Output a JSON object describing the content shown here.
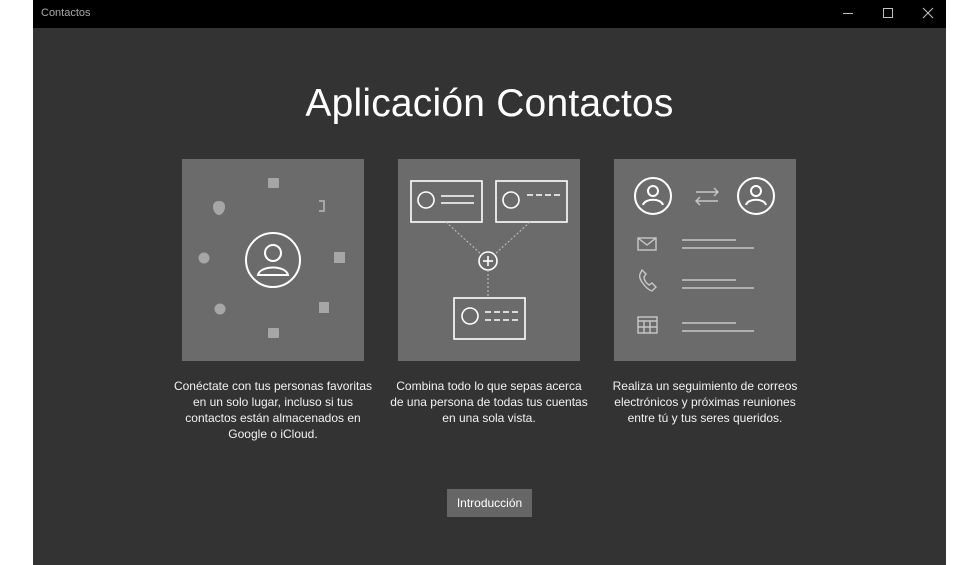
{
  "window": {
    "title": "Contactos",
    "controls": [
      "minimize-icon",
      "maximize-icon",
      "close-icon"
    ]
  },
  "heading": "Aplicación Contactos",
  "features": [
    {
      "icon": "account-sync-icon",
      "text": "Conéctate con tus personas favoritas en un solo lugar, incluso si tus contactos están almacenados en Google o iCloud."
    },
    {
      "icon": "merge-contacts-icon",
      "text": "Combina todo lo que sepas acerca de una persona de todas tus cuentas en una sola vista."
    },
    {
      "icon": "activity-tracking-icon",
      "text": "Realiza un seguimiento de correos electrónicos y próximas reuniones entre tú y tus seres queridos."
    }
  ],
  "intro_button": "Introducción",
  "colors": {
    "window_bg": "#333333",
    "titlebar_bg": "#000000",
    "card_bg": "#6b6b6b",
    "button_bg": "#666666"
  }
}
